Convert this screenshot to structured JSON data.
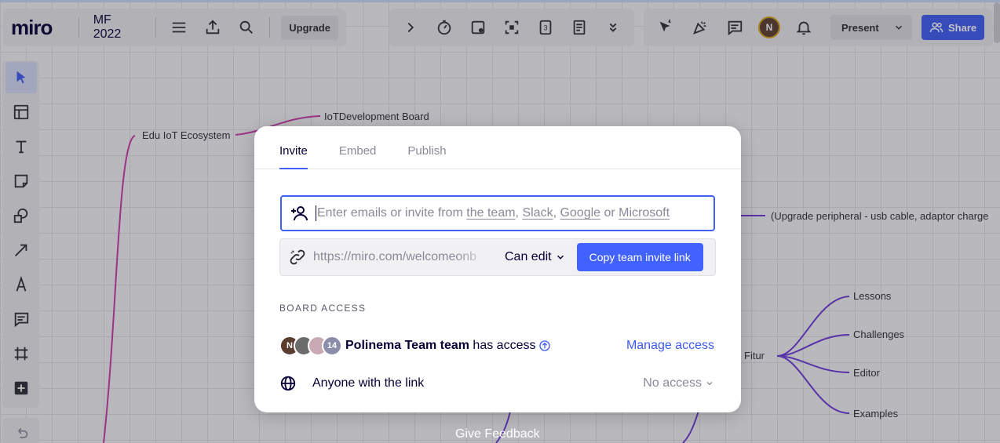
{
  "app": {
    "logo": "miro",
    "board_title": "MF 2022",
    "upgrade_label": "Upgrade",
    "present_label": "Present",
    "share_label": "Share",
    "user_avatar_initial": "N"
  },
  "toolbar_icons": [
    "menu-icon",
    "export-icon",
    "search-icon"
  ],
  "tools_icons": [
    "chevron-right-icon",
    "timer-icon",
    "cards-icon",
    "focus-icon",
    "countdown-icon",
    "notes-icon",
    "chevrons-down-icon"
  ],
  "right_icons": [
    "reactions-icon",
    "celebrate-icon",
    "comments-icon",
    "avatar",
    "bell-icon"
  ],
  "left_toolbar": [
    "select-icon",
    "templates-icon",
    "text-icon",
    "sticky-note-icon",
    "shapes-icon",
    "arrow-icon",
    "pen-icon",
    "comment-icon",
    "frame-icon",
    "add-icon"
  ],
  "canvas": {
    "nodes": {
      "edu": "Edu IoT Ecosystem",
      "iotdev": "IoTDevelopment Board",
      "upgrade_peripheral": "(Upgrade peripheral - usb cable, adaptor charge",
      "fitur": "Fitur",
      "lessons": "Lessons",
      "challenges": "Challenges",
      "editor": "Editor",
      "examples": "Examples"
    },
    "feedback": "Give Feedback"
  },
  "modal": {
    "tabs": [
      "Invite",
      "Embed",
      "Publish"
    ],
    "email_placeholder_prefix": "Enter emails or invite from ",
    "email_links": [
      "the team",
      "Slack",
      "Google",
      "Microsoft"
    ],
    "email_sep_1": ", ",
    "email_sep_2": ", ",
    "email_sep_3": " or ",
    "link_url": "https://miro.com/welcomeonb",
    "permission": "Can edit",
    "copy_button": "Copy team invite link",
    "section_label": "BOARD ACCESS",
    "team_avatars": [
      "N",
      "",
      "",
      "14"
    ],
    "team_name": "Polinema Team team",
    "team_suffix": " has access",
    "manage_access": "Manage access",
    "anyone_label": "Anyone with the link",
    "no_access": "No access"
  },
  "colors": {
    "accent": "#4262ff",
    "mindmap_pink": "#c838a8",
    "mindmap_purple": "#6a3ad6"
  }
}
